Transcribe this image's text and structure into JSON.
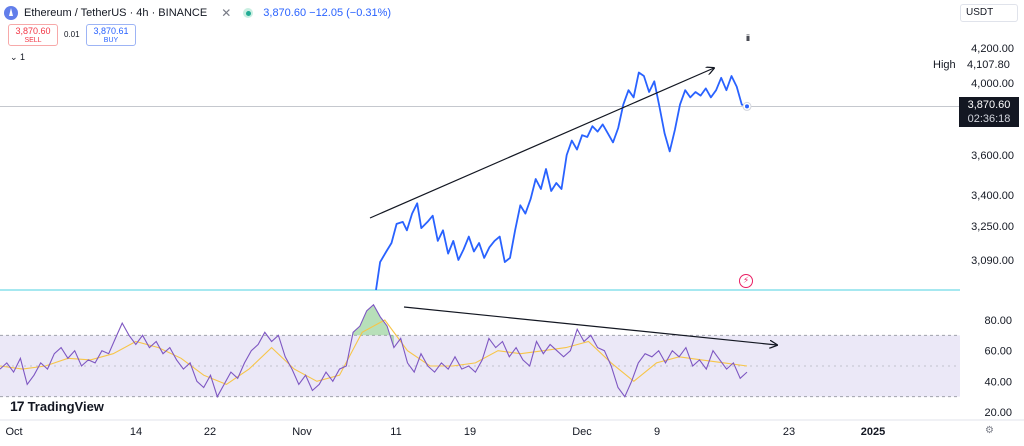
{
  "header": {
    "symbol": "Ethereum / TetherUS · 4h · BINANCE",
    "price_line": "3,870.60 −12.05 (−0.31%)",
    "close_icon": "x-icon",
    "status_icon": "live-dot-icon"
  },
  "trade": {
    "sell_price": "3,870.60",
    "sell_label": "SELL",
    "spread": "0.01",
    "buy_price": "3,870.61",
    "buy_label": "BUY",
    "collapse": "⌄ 1"
  },
  "currency": "USDT",
  "brand": "TradingView",
  "indicator_icon": "iii",
  "markers": {
    "high_label": "High",
    "high_value": "4,107.80",
    "last_price": "3,870.60",
    "countdown": "02:36:18"
  },
  "colors": {
    "price": "#2962ff",
    "rsi": "#7e57c2",
    "rsi_ma": "#f7c548",
    "rsi_band": "#ebe8f7",
    "baseline": "#4dd0e1",
    "arrow": "#131722"
  },
  "chart_data": [
    {
      "type": "line",
      "name_hint": "price",
      "x_range": [
        "Oct",
        "2025"
      ],
      "ticks_x": [
        "Oct",
        "14",
        "22",
        "Nov",
        "11",
        "19",
        "Dec",
        "9",
        "23",
        "2025"
      ],
      "ticks_y": [
        "4,200.00",
        "4,000.00",
        "3,600.00",
        "3,400.00",
        "3,250.00",
        "3,090.00"
      ],
      "ticks_y_values": [
        4200,
        4000,
        3600,
        3400,
        3250,
        3090
      ],
      "series": [
        {
          "values": [
            [
              0.0,
              2950
            ],
            [
              0.4,
              3080
            ],
            [
              1.0,
              3130
            ],
            [
              1.5,
              3170
            ],
            [
              2.0,
              3260
            ],
            [
              2.6,
              3270
            ],
            [
              3.0,
              3230
            ],
            [
              3.5,
              3310
            ],
            [
              4.0,
              3360
            ],
            [
              4.4,
              3240
            ],
            [
              5.0,
              3270
            ],
            [
              5.5,
              3300
            ],
            [
              6.0,
              3180
            ],
            [
              6.5,
              3230
            ],
            [
              7.0,
              3120
            ],
            [
              7.5,
              3180
            ],
            [
              8.0,
              3090
            ],
            [
              8.5,
              3140
            ],
            [
              9.0,
              3200
            ],
            [
              9.5,
              3130
            ],
            [
              10.0,
              3170
            ],
            [
              10.5,
              3100
            ],
            [
              11.0,
              3150
            ],
            [
              11.5,
              3180
            ],
            [
              12.0,
              3200
            ],
            [
              12.5,
              3080
            ],
            [
              13.0,
              3100
            ],
            [
              13.5,
              3230
            ],
            [
              14.0,
              3350
            ],
            [
              14.5,
              3310
            ],
            [
              15.0,
              3380
            ],
            [
              15.5,
              3480
            ],
            [
              16.0,
              3430
            ],
            [
              16.5,
              3530
            ],
            [
              17.0,
              3420
            ],
            [
              17.5,
              3460
            ],
            [
              18.0,
              3430
            ],
            [
              18.5,
              3600
            ],
            [
              19.0,
              3680
            ],
            [
              19.5,
              3630
            ],
            [
              20.0,
              3710
            ],
            [
              20.5,
              3700
            ],
            [
              21.0,
              3760
            ],
            [
              21.5,
              3730
            ],
            [
              22.0,
              3770
            ],
            [
              22.5,
              3720
            ],
            [
              23.0,
              3670
            ],
            [
              23.5,
              3750
            ],
            [
              24.0,
              3880
            ],
            [
              24.5,
              3960
            ],
            [
              25.0,
              3920
            ],
            [
              25.5,
              4060
            ],
            [
              26.0,
              4040
            ],
            [
              26.5,
              3950
            ],
            [
              27.0,
              4010
            ],
            [
              27.5,
              3870
            ],
            [
              28.0,
              3720
            ],
            [
              28.5,
              3620
            ],
            [
              29.0,
              3740
            ],
            [
              29.5,
              3880
            ],
            [
              30.0,
              3960
            ],
            [
              30.5,
              3920
            ],
            [
              31.0,
              3950
            ],
            [
              31.5,
              3930
            ],
            [
              32.0,
              3970
            ],
            [
              32.5,
              3920
            ],
            [
              33.0,
              3960
            ],
            [
              33.5,
              4030
            ],
            [
              34.0,
              3960
            ],
            [
              34.5,
              4040
            ],
            [
              35.0,
              3980
            ],
            [
              35.5,
              3880
            ],
            [
              36.0,
              3870
            ]
          ]
        }
      ]
    },
    {
      "type": "line",
      "name_hint": "rsi",
      "ticks_y": [
        "80.00",
        "60.00",
        "40.00",
        "20.00"
      ],
      "ticks_y_values": [
        80,
        60,
        40,
        20
      ],
      "band": [
        30,
        70
      ],
      "midline": 50,
      "series": [
        {
          "values": [
            [
              0,
              48
            ],
            [
              0.3,
              52
            ],
            [
              0.6,
              46
            ],
            [
              0.9,
              55
            ],
            [
              1.2,
              38
            ],
            [
              1.5,
              44
            ],
            [
              1.8,
              52
            ],
            [
              2.1,
              48
            ],
            [
              2.4,
              58
            ],
            [
              2.7,
              62
            ],
            [
              3,
              55
            ],
            [
              3.3,
              60
            ],
            [
              3.6,
              50
            ],
            [
              3.9,
              54
            ],
            [
              4.2,
              52
            ],
            [
              4.5,
              60
            ],
            [
              4.8,
              58
            ],
            [
              5.1,
              68
            ],
            [
              5.4,
              78
            ],
            [
              5.7,
              70
            ],
            [
              6,
              64
            ],
            [
              6.3,
              70
            ],
            [
              6.6,
              62
            ],
            [
              6.9,
              66
            ],
            [
              7.2,
              58
            ],
            [
              7.5,
              62
            ],
            [
              7.8,
              54
            ],
            [
              8.1,
              48
            ],
            [
              8.4,
              52
            ],
            [
              8.7,
              40
            ],
            [
              9,
              36
            ],
            [
              9.3,
              44
            ],
            [
              9.6,
              30
            ],
            [
              9.9,
              38
            ],
            [
              10.2,
              46
            ],
            [
              10.5,
              42
            ],
            [
              10.8,
              52
            ],
            [
              11.1,
              60
            ],
            [
              11.4,
              64
            ],
            [
              11.7,
              72
            ],
            [
              12,
              66
            ],
            [
              12.3,
              70
            ],
            [
              12.6,
              56
            ],
            [
              12.9,
              48
            ],
            [
              13.2,
              38
            ],
            [
              13.5,
              44
            ],
            [
              13.8,
              34
            ],
            [
              14.1,
              38
            ],
            [
              14.4,
              46
            ],
            [
              14.7,
              40
            ],
            [
              15,
              48
            ],
            [
              15.3,
              50
            ],
            [
              15.6,
              72
            ],
            [
              15.9,
              76
            ],
            [
              16.2,
              86
            ],
            [
              16.5,
              90
            ],
            [
              16.8,
              82
            ],
            [
              17.1,
              76
            ],
            [
              17.4,
              62
            ],
            [
              17.7,
              68
            ],
            [
              18,
              52
            ],
            [
              18.3,
              46
            ],
            [
              18.6,
              58
            ],
            [
              18.9,
              50
            ],
            [
              19.2,
              46
            ],
            [
              19.5,
              52
            ],
            [
              19.8,
              48
            ],
            [
              20.1,
              56
            ],
            [
              20.4,
              48
            ],
            [
              20.7,
              50
            ],
            [
              21,
              46
            ],
            [
              21.3,
              54
            ],
            [
              21.6,
              68
            ],
            [
              21.9,
              62
            ],
            [
              22.2,
              66
            ],
            [
              22.5,
              56
            ],
            [
              22.8,
              62
            ],
            [
              23.1,
              54
            ],
            [
              23.4,
              50
            ],
            [
              23.7,
              66
            ],
            [
              24,
              58
            ],
            [
              24.3,
              64
            ],
            [
              24.6,
              60
            ],
            [
              24.9,
              56
            ],
            [
              25.2,
              60
            ],
            [
              25.5,
              74
            ],
            [
              25.8,
              66
            ],
            [
              26.1,
              70
            ],
            [
              26.4,
              62
            ],
            [
              26.7,
              60
            ],
            [
              27,
              50
            ],
            [
              27.3,
              36
            ],
            [
              27.6,
              30
            ],
            [
              27.9,
              40
            ],
            [
              28.2,
              52
            ],
            [
              28.5,
              58
            ],
            [
              28.8,
              56
            ],
            [
              29.1,
              60
            ],
            [
              29.4,
              52
            ],
            [
              29.7,
              60
            ],
            [
              30,
              56
            ],
            [
              30.3,
              62
            ],
            [
              30.6,
              50
            ],
            [
              30.9,
              54
            ],
            [
              31.2,
              48
            ],
            [
              31.5,
              60
            ],
            [
              31.8,
              54
            ],
            [
              32.1,
              48
            ],
            [
              32.4,
              52
            ],
            [
              32.7,
              42
            ],
            [
              33,
              46
            ]
          ]
        },
        {
          "values": [
            [
              0,
              50
            ],
            [
              1,
              48
            ],
            [
              2,
              50
            ],
            [
              3,
              55
            ],
            [
              4,
              54
            ],
            [
              5,
              58
            ],
            [
              6,
              66
            ],
            [
              7,
              62
            ],
            [
              8,
              55
            ],
            [
              9,
              44
            ],
            [
              10,
              38
            ],
            [
              11,
              48
            ],
            [
              12,
              62
            ],
            [
              13,
              48
            ],
            [
              14,
              40
            ],
            [
              15,
              44
            ],
            [
              16,
              72
            ],
            [
              17,
              80
            ],
            [
              18,
              60
            ],
            [
              19,
              50
            ],
            [
              20,
              50
            ],
            [
              21,
              52
            ],
            [
              22,
              60
            ],
            [
              23,
              58
            ],
            [
              24,
              60
            ],
            [
              25,
              62
            ],
            [
              26,
              66
            ],
            [
              27,
              52
            ],
            [
              28,
              40
            ],
            [
              29,
              52
            ],
            [
              30,
              56
            ],
            [
              31,
              54
            ],
            [
              32,
              52
            ],
            [
              33,
              50
            ]
          ]
        }
      ]
    }
  ]
}
